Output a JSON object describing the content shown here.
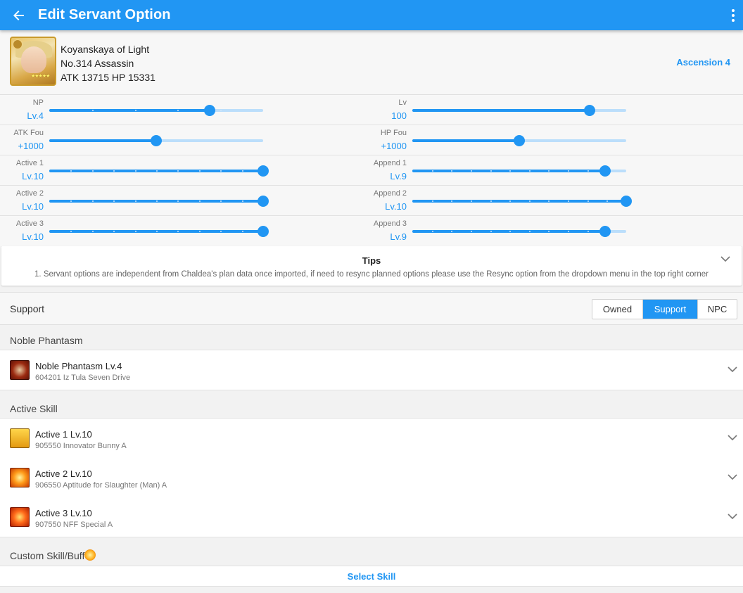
{
  "appbar": {
    "title": "Edit Servant Option"
  },
  "servant": {
    "name": "Koyanskaya of Light",
    "id_class": "No.314  Assassin",
    "stats": "ATK 13715  HP 15331",
    "ascension": "Ascension 4"
  },
  "sliders": {
    "np": {
      "label": "NP",
      "value": "Lv.4",
      "fraction": 0.75
    },
    "lv": {
      "label": "Lv",
      "value": "100",
      "fraction": 0.83
    },
    "atk_fou": {
      "label": "ATK Fou",
      "value": "+1000",
      "fraction": 0.5
    },
    "hp_fou": {
      "label": "HP Fou",
      "value": "+1000",
      "fraction": 0.5
    },
    "active1": {
      "label": "Active 1",
      "value": "Lv.10",
      "fraction": 1.0
    },
    "append1": {
      "label": "Append 1",
      "value": "Lv.9",
      "fraction": 0.9
    },
    "active2": {
      "label": "Active 2",
      "value": "Lv.10",
      "fraction": 1.0
    },
    "append2": {
      "label": "Append 2",
      "value": "Lv.10",
      "fraction": 1.0
    },
    "active3": {
      "label": "Active 3",
      "value": "Lv.10",
      "fraction": 1.0
    },
    "append3": {
      "label": "Append 3",
      "value": "Lv.9",
      "fraction": 0.9
    }
  },
  "tips": {
    "title": "Tips",
    "text": "1. Servant options are independent from Chaldea's plan data once imported, if need to resync planned options please use the Resync option from the dropdown menu in the top right corner"
  },
  "support": {
    "label": "Support",
    "options": [
      "Owned",
      "Support",
      "NPC"
    ],
    "selected": "Support"
  },
  "noble_phantasm": {
    "header": "Noble Phantasm",
    "title": "Noble Phantasm Lv.4",
    "subtitle": "604201 Iz Tula Seven Drive"
  },
  "active_skill": {
    "header": "Active Skill",
    "items": [
      {
        "title": "Active 1 Lv.10",
        "subtitle": "905550 Innovator Bunny A"
      },
      {
        "title": "Active 2 Lv.10",
        "subtitle": "906550 Aptitude for Slaughter (Man) A"
      },
      {
        "title": "Active 3 Lv.10",
        "subtitle": "907550 NFF Special A"
      }
    ]
  },
  "custom_skill": {
    "header": "Custom Skill/Buff",
    "select_label": "Select Skill"
  },
  "colors": {
    "accent": "#2196f3",
    "track_light": "#bbdefb"
  }
}
